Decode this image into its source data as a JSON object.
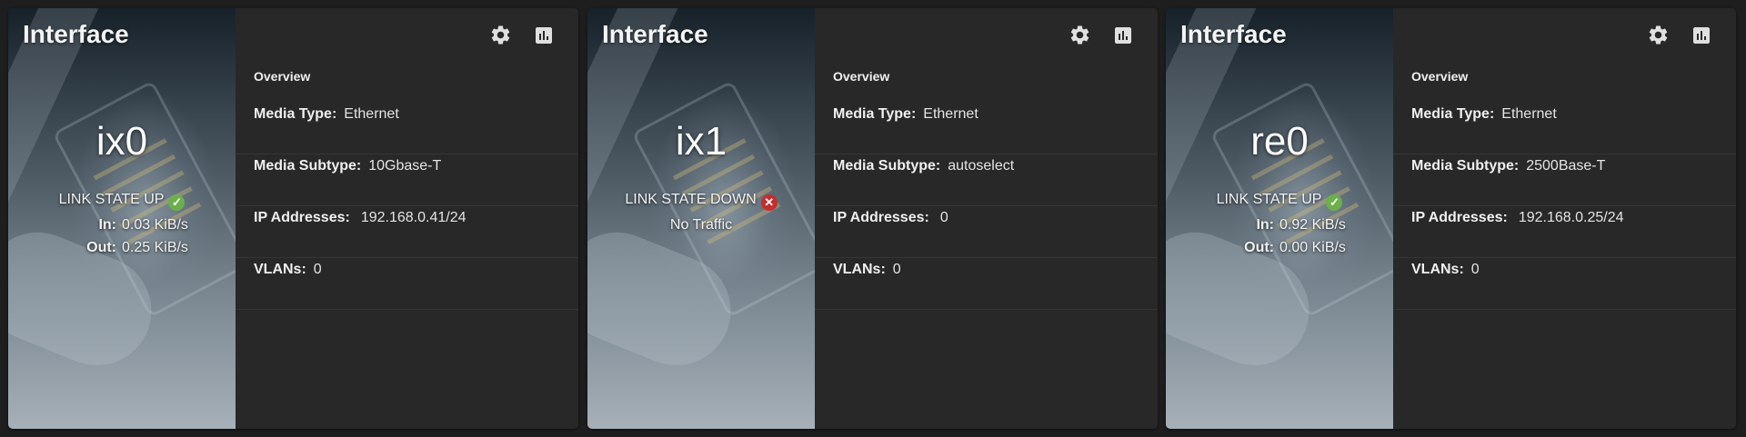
{
  "cards": [
    {
      "title": "Interface",
      "name": "ix0",
      "link_state": "LINK STATE UP",
      "link_up": true,
      "in_label": "In:",
      "in_value": "0.03 KiB/s",
      "out_label": "Out:",
      "out_value": "0.25 KiB/s",
      "no_traffic": "",
      "overview_label": "Overview",
      "media_type_label": "Media Type:",
      "media_type": "Ethernet",
      "media_subtype_label": "Media Subtype:",
      "media_subtype": "10Gbase-T",
      "ip_label": "IP Addresses:",
      "ip": "192.168.0.41/24",
      "vlans_label": "VLANs:",
      "vlans": "0"
    },
    {
      "title": "Interface",
      "name": "ix1",
      "link_state": "LINK STATE DOWN",
      "link_up": false,
      "in_label": "",
      "in_value": "",
      "out_label": "",
      "out_value": "",
      "no_traffic": "No Traffic",
      "overview_label": "Overview",
      "media_type_label": "Media Type:",
      "media_type": "Ethernet",
      "media_subtype_label": "Media Subtype:",
      "media_subtype": "autoselect",
      "ip_label": "IP Addresses:",
      "ip": "0",
      "vlans_label": "VLANs:",
      "vlans": "0"
    },
    {
      "title": "Interface",
      "name": "re0",
      "link_state": "LINK STATE UP",
      "link_up": true,
      "in_label": "In:",
      "in_value": "0.92 KiB/s",
      "out_label": "Out:",
      "out_value": "0.00 KiB/s",
      "no_traffic": "",
      "overview_label": "Overview",
      "media_type_label": "Media Type:",
      "media_type": "Ethernet",
      "media_subtype_label": "Media Subtype:",
      "media_subtype": "2500Base-T",
      "ip_label": "IP Addresses:",
      "ip": "192.168.0.25/24",
      "vlans_label": "VLANs:",
      "vlans": "0"
    }
  ],
  "icons": {
    "settings": "gear-icon",
    "stats": "bar-chart-icon",
    "status_up": "check-circle-icon",
    "status_down": "close-circle-icon"
  },
  "colors": {
    "status_up": "#6bb04b",
    "status_down": "#c62d2d",
    "card_background": "#282828",
    "page_background": "#1e1e1e"
  }
}
